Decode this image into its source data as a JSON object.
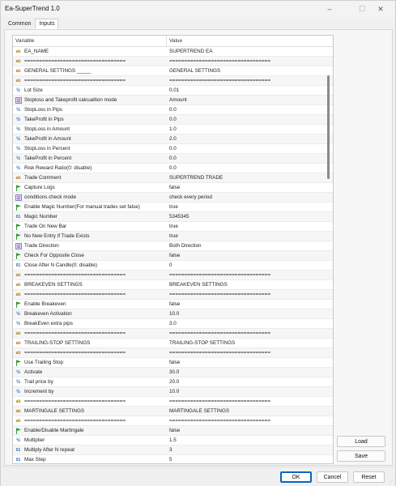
{
  "window": {
    "title": "Ea-SuperTrend 1.0",
    "minimize": "–",
    "maximize": "☐",
    "close": "✕"
  },
  "tabs": [
    {
      "label": "Common"
    },
    {
      "label": "Inputs"
    }
  ],
  "grid": {
    "header_variable": "Variable",
    "header_value": "Value",
    "rows": [
      {
        "icon": "ab",
        "variable": "EA_NAME",
        "value": "SUPERTREND EA"
      },
      {
        "icon": "ab",
        "variable": "==================================",
        "value": "=================================="
      },
      {
        "icon": "ab",
        "variable": "GENERAL SETTINGS _____",
        "value": "GENERAL SETTINGS"
      },
      {
        "icon": "ab",
        "variable": "==================================",
        "value": "=================================="
      },
      {
        "icon": "half",
        "variable": "Lot Size",
        "value": "0.01"
      },
      {
        "icon": "list",
        "variable": "Stoploss and Takeprofit calcualtion mode",
        "value": "Amount"
      },
      {
        "icon": "half",
        "variable": "StopLoss in Pips",
        "value": "0.0"
      },
      {
        "icon": "half",
        "variable": "TakeProfit in Pips",
        "value": "0.0"
      },
      {
        "icon": "half",
        "variable": "StopLoss in Amount",
        "value": "1.0"
      },
      {
        "icon": "half",
        "variable": "TakeProfit in Amount",
        "value": "2.0"
      },
      {
        "icon": "half",
        "variable": "StopLoss in Percent",
        "value": "0.0"
      },
      {
        "icon": "half",
        "variable": "TakeProfit in Percent",
        "value": "0.0"
      },
      {
        "icon": "half",
        "variable": "Risk Reward Ratio(0: disable)",
        "value": "0.0"
      },
      {
        "icon": "ab",
        "variable": "Trade Comment",
        "value": "SUPERTREND TRADE"
      },
      {
        "icon": "flag",
        "variable": "Capture Logs",
        "value": "false"
      },
      {
        "icon": "list",
        "variable": "conditions check mode",
        "value": "check every period"
      },
      {
        "icon": "flag",
        "variable": "Enable Magic Number(For manual trades set false)",
        "value": "true"
      },
      {
        "icon": "01",
        "variable": "Magic Number",
        "value": "5345345"
      },
      {
        "icon": "flag",
        "variable": "Trade On New Bar",
        "value": "true"
      },
      {
        "icon": "flag",
        "variable": "No New Entry If Trade Exists",
        "value": "true"
      },
      {
        "icon": "list",
        "variable": "Trade Direction",
        "value": "Both Direction"
      },
      {
        "icon": "flag",
        "variable": "Check For Opposite Close",
        "value": "false"
      },
      {
        "icon": "01",
        "variable": "Close After N Candle(0: disable)",
        "value": "0"
      },
      {
        "icon": "ab",
        "variable": "==================================",
        "value": "=================================="
      },
      {
        "icon": "ab",
        "variable": "BREAKEVEN SETTINGS",
        "value": "BREAKEVEN SETTINGS"
      },
      {
        "icon": "ab",
        "variable": "==================================",
        "value": "=================================="
      },
      {
        "icon": "flag",
        "variable": "Enable Breakeven",
        "value": "false"
      },
      {
        "icon": "half",
        "variable": "Breakeven Activation",
        "value": "10.0"
      },
      {
        "icon": "half",
        "variable": "BreakEven extra pips",
        "value": "3.0"
      },
      {
        "icon": "ab",
        "variable": "==================================",
        "value": "=================================="
      },
      {
        "icon": "ab",
        "variable": "TRAILING-STOP SETTINGS",
        "value": "TRAILING-STOP SETTINGS"
      },
      {
        "icon": "ab",
        "variable": "==================================",
        "value": "=================================="
      },
      {
        "icon": "flag",
        "variable": "Use Trailing Stop",
        "value": "false"
      },
      {
        "icon": "half",
        "variable": "Activate",
        "value": "30.0"
      },
      {
        "icon": "half",
        "variable": "Trail price by",
        "value": "20.0"
      },
      {
        "icon": "half",
        "variable": "Increment by",
        "value": "10.0"
      },
      {
        "icon": "ab",
        "variable": "==================================",
        "value": "=================================="
      },
      {
        "icon": "ab",
        "variable": "MARTINGALE SETTINGS",
        "value": "MARTINGALE SETTINGS"
      },
      {
        "icon": "ab",
        "variable": "==================================",
        "value": "=================================="
      },
      {
        "icon": "flag",
        "variable": "Enable/Disable Martingale",
        "value": "false"
      },
      {
        "icon": "half",
        "variable": "Multiplier",
        "value": "1.5"
      },
      {
        "icon": "01",
        "variable": "Multiply After N repeat",
        "value": "3"
      },
      {
        "icon": "01",
        "variable": "Max Step",
        "value": "5"
      }
    ]
  },
  "side_buttons": {
    "load": "Load",
    "save": "Save"
  },
  "footer": {
    "ok": "OK",
    "cancel": "Cancel",
    "reset": "Reset"
  },
  "colors": {
    "accent": "#0067c0",
    "ab_icon": "#b57b00",
    "num_icon": "#1f6cc5",
    "flag_icon": "#2e9a2e"
  }
}
